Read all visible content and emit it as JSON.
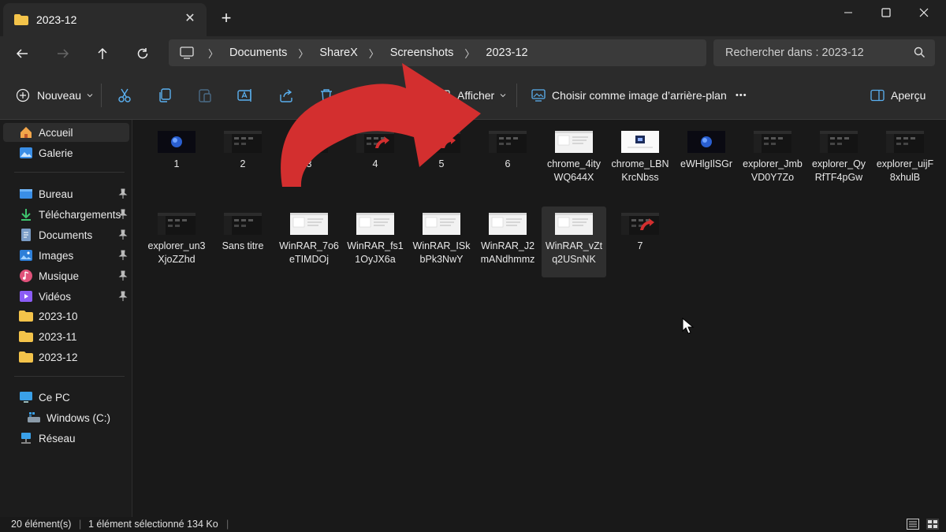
{
  "window": {
    "tab_title": "2023-12",
    "new_tab_label": "+",
    "close_tab_label": "✕"
  },
  "nav": {
    "breadcrumbs": [
      "Documents",
      "ShareX",
      "Screenshots",
      "2023-12"
    ],
    "search_placeholder": "Rechercher dans : 2023-12"
  },
  "toolbar": {
    "new_label": "Nouveau",
    "view_label": "Afficher",
    "wallpaper_label": "Choisir comme image d’arrière-plan",
    "more_label": "•••",
    "preview_label": "Aperçu"
  },
  "sidebar": {
    "items": [
      {
        "label": "Accueil",
        "icon": "home-icon"
      },
      {
        "label": "Galerie",
        "icon": "gallery-icon"
      },
      {
        "label": "Bureau",
        "icon": "desktop-icon"
      },
      {
        "label": "Téléchargements",
        "icon": "download-icon"
      },
      {
        "label": "Documents",
        "icon": "documents-icon"
      },
      {
        "label": "Images",
        "icon": "pictures-icon"
      },
      {
        "label": "Musique",
        "icon": "music-icon"
      },
      {
        "label": "Vidéos",
        "icon": "videos-icon"
      },
      {
        "label": "2023-10",
        "icon": "folder-icon"
      },
      {
        "label": "2023-11",
        "icon": "folder-icon"
      },
      {
        "label": "2023-12",
        "icon": "folder-icon"
      },
      {
        "label": "Ce PC",
        "icon": "pc-icon"
      },
      {
        "label": "Windows (C:)",
        "icon": "drive-icon"
      },
      {
        "label": "Réseau",
        "icon": "network-icon"
      }
    ]
  },
  "files": [
    {
      "name": "1",
      "thumb": "globe"
    },
    {
      "name": "2",
      "thumb": "dark"
    },
    {
      "name": "3",
      "thumb": "dark"
    },
    {
      "name": "4",
      "thumb": "dark-red"
    },
    {
      "name": "5",
      "thumb": "dark-red"
    },
    {
      "name": "6",
      "thumb": "dark"
    },
    {
      "name": "chrome_4ityWQ644X",
      "thumb": "light"
    },
    {
      "name": "chrome_LBNKrcNbss",
      "thumb": "light-blue"
    },
    {
      "name": "eWHlgIlSGr",
      "thumb": "globe"
    },
    {
      "name": "explorer_JmbVD0Y7Zo",
      "thumb": "dark"
    },
    {
      "name": "explorer_QyRfTF4pGw",
      "thumb": "dark"
    },
    {
      "name": "explorer_uijF8xhulB",
      "thumb": "dark"
    },
    {
      "name": "explorer_un3XjoZZhd",
      "thumb": "dark"
    },
    {
      "name": "Sans titre",
      "thumb": "dark"
    },
    {
      "name": "WinRAR_7o6eTIMDOj",
      "thumb": "light"
    },
    {
      "name": "WinRAR_fs11OyJX6a",
      "thumb": "light"
    },
    {
      "name": "WinRAR_ISkbPk3NwY",
      "thumb": "light"
    },
    {
      "name": "WinRAR_J2mANdhmmz",
      "thumb": "light"
    },
    {
      "name": "WinRAR_vZtq2USnNK",
      "thumb": "light"
    },
    {
      "name": "7",
      "thumb": "dark-red"
    }
  ],
  "selected_file": "WinRAR_vZtq2USnNK",
  "status": {
    "count": "20 élément(s)",
    "selection": "1 élément sélectionné  134 Ko"
  },
  "colors": {
    "accent_red": "#d32f2f",
    "folder_yellow": "#f3c34a",
    "background": "#191919"
  }
}
